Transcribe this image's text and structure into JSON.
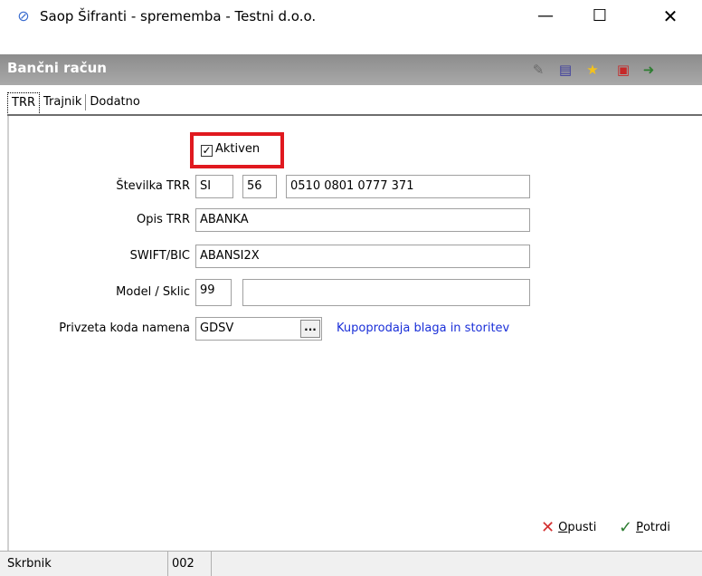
{
  "window": {
    "title": "Saop Šifranti - sprememba - Testni d.o.o.",
    "minimize": "—",
    "maximize": "☐",
    "close": "✕"
  },
  "header": {
    "title": "Bančni račun",
    "icons": [
      "edit-icon",
      "list-icon",
      "star-icon",
      "document-icon",
      "exit-icon"
    ]
  },
  "tabs": [
    {
      "label": "TRR",
      "active": true
    },
    {
      "label": "Trajnik",
      "active": false
    },
    {
      "label": "Dodatno",
      "active": false
    }
  ],
  "form": {
    "active": {
      "label": "Aktiven",
      "checked": true
    },
    "trr": {
      "label": "Številka TRR",
      "country": "SI",
      "check": "56",
      "number": "0510 0801 0777 371"
    },
    "opis": {
      "label": "Opis TRR",
      "value": "ABANKA"
    },
    "swift": {
      "label": "SWIFT/BIC",
      "value": "ABANSI2X"
    },
    "model": {
      "label": "Model / Sklic",
      "model": "99",
      "sklic": ""
    },
    "koda": {
      "label": "Privzeta koda namena",
      "value": "GDSV",
      "browse": "...",
      "description": "Kupoprodaja blaga in storitev"
    }
  },
  "buttons": {
    "cancel": {
      "underline": "O",
      "rest": "pusti"
    },
    "ok": {
      "underline": "P",
      "rest": "otrdi"
    }
  },
  "statusbar": {
    "label": "Skrbnik",
    "value": "002"
  },
  "colors": {
    "highlight": "#e0191f",
    "link": "#1a2fd8",
    "header": "#9a9a9a"
  }
}
